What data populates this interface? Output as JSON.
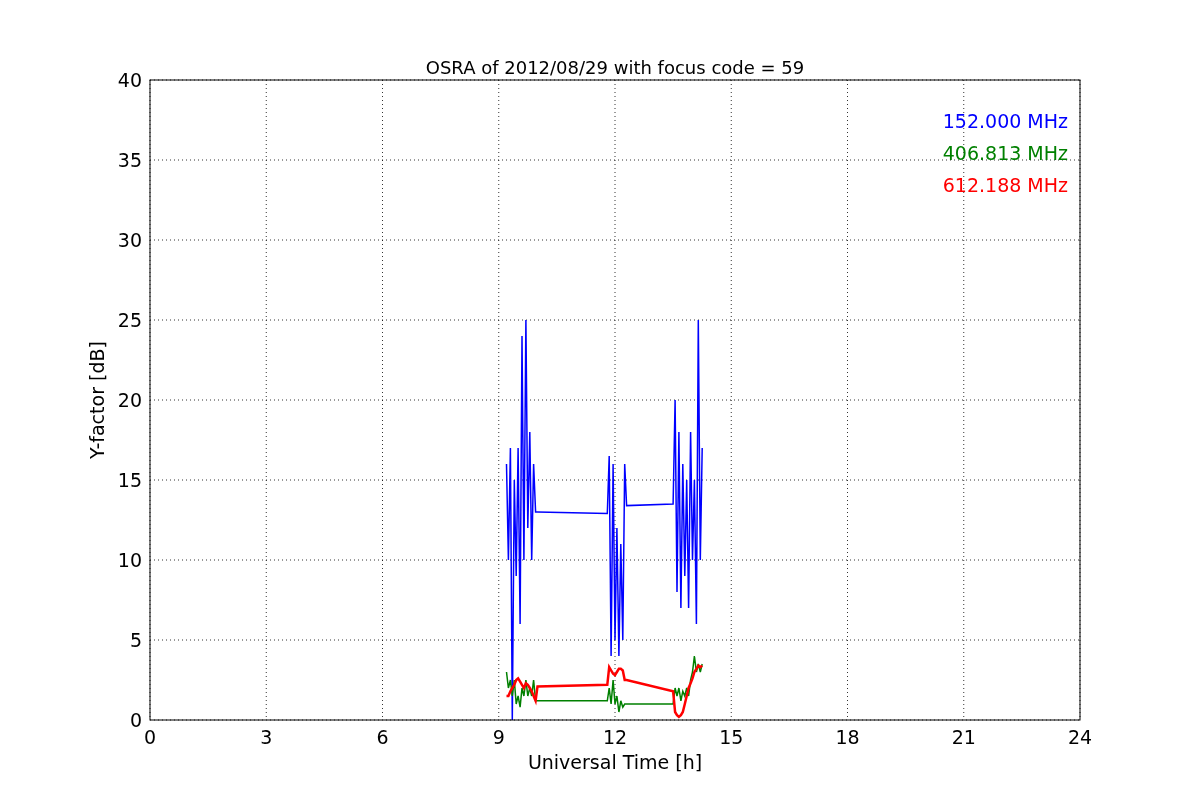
{
  "figure": {
    "chart_data": {
      "type": "line",
      "title": "OSRA of 2012/08/29 with focus code = 59",
      "xlabel": "Universal Time [h]",
      "ylabel": "Y-factor [dB]",
      "x": [
        9.2,
        9.25,
        9.3,
        9.35,
        9.4,
        9.45,
        9.5,
        9.55,
        9.6,
        9.65,
        9.7,
        9.75,
        9.8,
        9.85,
        9.9,
        9.95,
        10.0,
        11.8,
        11.85,
        11.9,
        11.95,
        12.0,
        12.05,
        12.1,
        12.15,
        12.2,
        12.25,
        12.3,
        13.5,
        13.55,
        13.6,
        13.65,
        13.7,
        13.75,
        13.8,
        13.85,
        13.9,
        13.95,
        14.0,
        14.05,
        14.1,
        14.15,
        14.2,
        14.25
      ],
      "series": [
        {
          "name": "152.000 MHz",
          "color": "#0000ff",
          "values": [
            16,
            10,
            17,
            0,
            15,
            9,
            17,
            6,
            24,
            10,
            25,
            12,
            18,
            10,
            16,
            13,
            13,
            12.9,
            16.5,
            4,
            16,
            5,
            12,
            4,
            11,
            5,
            16,
            13.4,
            13.5,
            20,
            8,
            18,
            7,
            16,
            9,
            15,
            7,
            18,
            10,
            15,
            6,
            25,
            10,
            17
          ]
        },
        {
          "name": "406.813 MHz",
          "color": "#008000",
          "values": [
            3,
            2,
            2.5,
            1.5,
            2.5,
            1,
            1.5,
            0.8,
            2,
            1.5,
            2.5,
            1.5,
            2,
            1.5,
            2.5,
            1.2,
            1.2,
            1.2,
            2,
            1,
            2.5,
            1,
            1.5,
            0.5,
            1.2,
            0.8,
            1,
            1,
            1,
            2,
            1.5,
            2,
            1.2,
            1.8,
            1.5,
            2,
            1.5,
            2.5,
            3,
            4,
            3,
            3.5,
            3,
            3.5
          ]
        },
        {
          "name": "612.188 MHz",
          "color": "#ff0000",
          "values": [
            1.5,
            1.5,
            1.8,
            2,
            2.2,
            2.5,
            2.6,
            2.4,
            2.2,
            2,
            2.3,
            2.2,
            2,
            1.8,
            1.5,
            1.2,
            2.1,
            2.2,
            3.3,
            3.1,
            2.9,
            2.8,
            3.0,
            3.2,
            3.2,
            3.1,
            2.5,
            2.5,
            1.8,
            0.5,
            0.3,
            0.2,
            0.3,
            0.5,
            1,
            1.5,
            2,
            2.3,
            2.6,
            3,
            3.2,
            3.4,
            3.3,
            3.4
          ]
        }
      ],
      "xlim": [
        0,
        24
      ],
      "ylim": [
        0,
        40
      ],
      "grid": true,
      "xticks": [
        0,
        3,
        6,
        9,
        12,
        15,
        18,
        21,
        24
      ],
      "yticks": [
        0,
        5,
        10,
        15,
        20,
        25,
        30,
        35,
        40
      ]
    }
  }
}
